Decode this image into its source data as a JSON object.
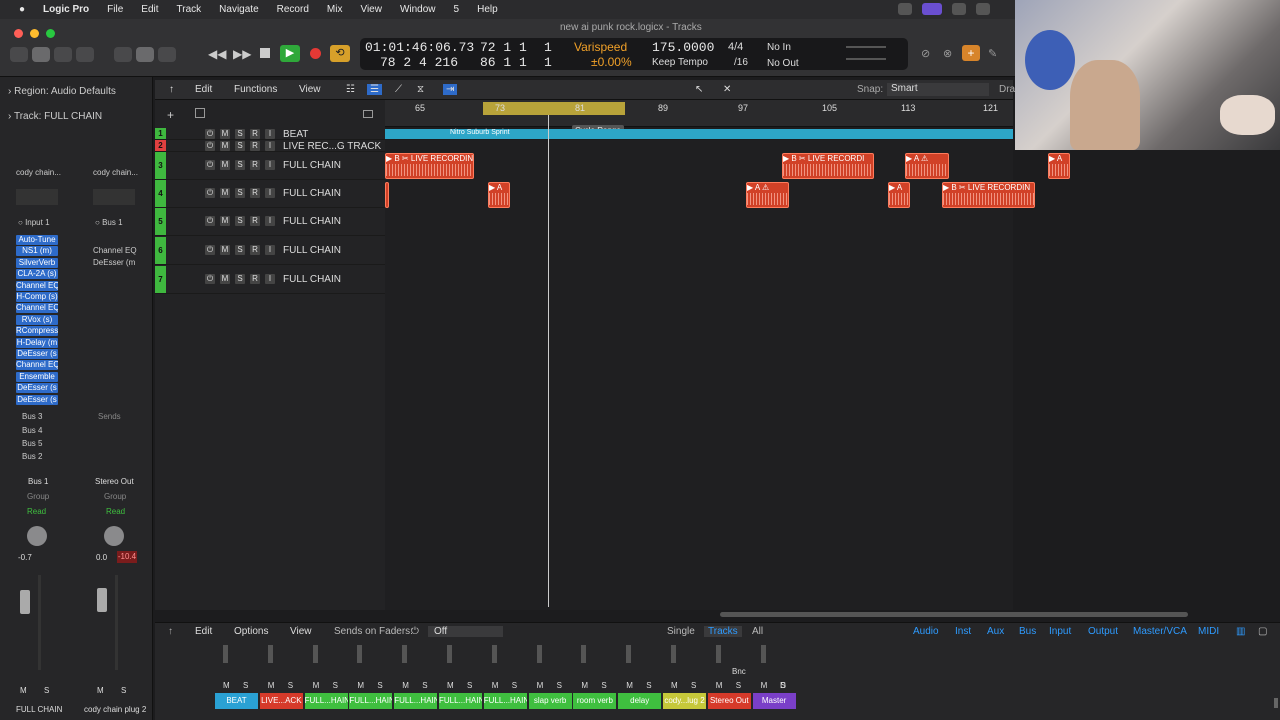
{
  "menubar": {
    "apple": "",
    "app": "Logic Pro",
    "items": [
      "File",
      "Edit",
      "Track",
      "Navigate",
      "Record",
      "Mix",
      "View",
      "Window",
      "5",
      "Help"
    ]
  },
  "window": {
    "title": "new ai punk rock.logicx - Tracks"
  },
  "lcd": {
    "time": "01:01:46:06.73",
    "bars": "72  1  1",
    "bars_sub": "1",
    "bars2": "78  2  4  216",
    "bars3": "86  1  1",
    "bars3_sub": "1",
    "varispeed_label": "Varispeed",
    "varispeed_value": "±0.00%",
    "tempo": "175.0000",
    "tempo_mode": "Keep Tempo",
    "sig": "4/4",
    "div": "/16",
    "in": "No In",
    "out": "No Out"
  },
  "inspector": {
    "region_label": "Region:",
    "region_value": "Audio Defaults",
    "track_label": "Track:",
    "track_value": "FULL CHAIN",
    "strip1": {
      "setting": "cody chain...",
      "input": "Input 1",
      "plugins": [
        "Auto-Tune",
        "NS1 (m)",
        "SilverVerb",
        "CLA-2A (s)",
        "Channel EQ",
        "H-Comp (s)",
        "Channel EQ",
        "RVox (s)",
        "RCompresso",
        "H-Delay (m",
        "DeEsser (s",
        "Channel EQ",
        "Ensemble",
        "DeEsser (s",
        "DeEsser (s"
      ],
      "sends": [
        "Bus 3",
        "Bus 4",
        "Bus 5",
        "Bus 2"
      ],
      "output": "Bus 1",
      "group": "Group",
      "auto": "Read",
      "pan": "-0.7",
      "name": "FULL CHAIN"
    },
    "strip2": {
      "setting": "cody chain...",
      "input": "Bus 1",
      "plugins": [
        "Channel EQ",
        "DeEsser (m"
      ],
      "sends_label": "Sends",
      "output": "Stereo Out",
      "group": "Group",
      "auto": "Read",
      "pan": "0.0",
      "peak": "-10.4",
      "name": "cody chain plug 2"
    },
    "m": "M",
    "s": "S"
  },
  "tracks_toolbar": {
    "edit": "Edit",
    "functions": "Functions",
    "view": "View",
    "snap_label": "Snap:",
    "snap_value": "Smart",
    "drag": "Dra"
  },
  "ruler": {
    "marks": [
      "65",
      "73",
      "81",
      "89",
      "97",
      "105",
      "113",
      "121"
    ],
    "cycle_label": "Cycle Range"
  },
  "arrangement_marker": "Nitro Suburb Sprint",
  "tracks": [
    {
      "num": "1",
      "name": "BEAT",
      "color": "#3fb83f"
    },
    {
      "num": "2",
      "name": "LIVE REC...G TRACK",
      "color": "#e04040"
    },
    {
      "num": "3",
      "name": "FULL CHAIN",
      "color": "#3fb83f"
    },
    {
      "num": "4",
      "name": "FULL CHAIN",
      "color": "#3fb83f"
    },
    {
      "num": "5",
      "name": "FULL CHAIN",
      "color": "#3fb83f"
    },
    {
      "num": "6",
      "name": "FULL CHAIN",
      "color": "#3fb83f"
    },
    {
      "num": "7",
      "name": "FULL CHAIN",
      "color": "#3fb83f"
    }
  ],
  "regions": {
    "r1": "▶ B ✂ LIVE RECORDIN",
    "r2": "▶ A",
    "r3": "▶ B ✂ LIVE RECORDI",
    "r4": "▶ A ⚠",
    "r5": "▶ A",
    "r6": "▶ A ⚠",
    "r7": "▶ A",
    "r8": "▶ B ✂ LIVE RECORDIN"
  },
  "mixer": {
    "edit": "Edit",
    "options": "Options",
    "view": "View",
    "sends_on_faders": "Sends on Faders:",
    "off": "Off",
    "single": "Single",
    "tracks": "Tracks",
    "all": "All",
    "filters": [
      "Audio",
      "Inst",
      "Aux",
      "Bus",
      "Input",
      "Output",
      "Master/VCA",
      "MIDI"
    ],
    "channels": [
      {
        "name": "BEAT",
        "color": "#2aa1d4"
      },
      {
        "name": "LIVE...ACK",
        "color": "#d63a2a"
      },
      {
        "name": "FULL...HAIN",
        "color": "#3fbf3f"
      },
      {
        "name": "FULL...HAIN",
        "color": "#3fbf3f"
      },
      {
        "name": "FULL...HAIN",
        "color": "#3fbf3f"
      },
      {
        "name": "FULL...HAIN",
        "color": "#3fbf3f"
      },
      {
        "name": "FULL...HAIN",
        "color": "#3fbf3f"
      },
      {
        "name": "slap verb",
        "color": "#3fbf3f"
      },
      {
        "name": "room verb",
        "color": "#3fbf3f"
      },
      {
        "name": "delay",
        "color": "#3fbf3f"
      },
      {
        "name": "cody...lug 2",
        "color": "#c6c83a"
      },
      {
        "name": "Stereo Out",
        "color": "#d63a2a"
      },
      {
        "name": "Master",
        "color": "#7a3fc8"
      }
    ],
    "bnc": "Bnc",
    "d": "D"
  }
}
